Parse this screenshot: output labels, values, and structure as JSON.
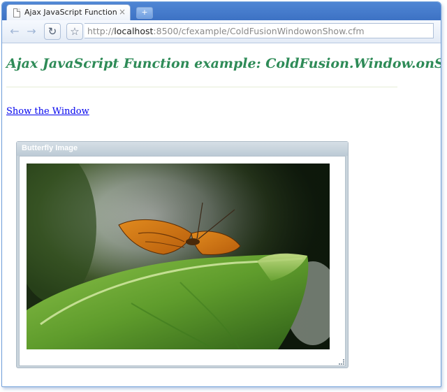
{
  "browser": {
    "tab_title": "Ajax JavaScript Function: ...",
    "tab_close": "×",
    "new_tab": "+",
    "address": {
      "prefix": "http://",
      "host": "localhost",
      "rest": ":8500/cfexample/ColdFusionWindowonShow.cfm"
    }
  },
  "page": {
    "title": "Ajax JavaScript Function example: ColdFusion.Window.onShow",
    "link_label": "Show the Window"
  },
  "window": {
    "title": "Butterfly Image"
  },
  "colors": {
    "title_green": "#2e8b57",
    "link_blue": "#0000ee",
    "chrome_blue": "#4f86d4"
  }
}
